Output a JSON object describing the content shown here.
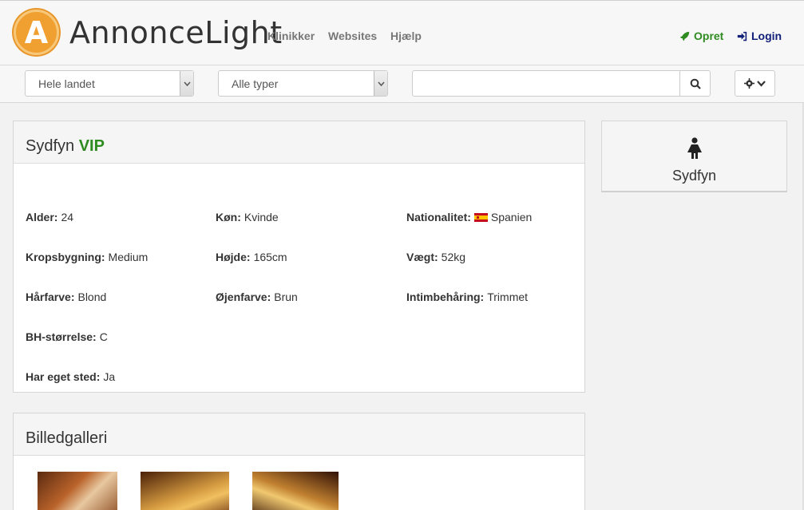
{
  "header": {
    "logo_letter": "A",
    "brand_strong": "Annonce",
    "brand_light": "Light",
    "nav": [
      "Klinikker",
      "Websites",
      "Hjælp"
    ],
    "opret_label": "Opret",
    "login_label": "Login"
  },
  "filters": {
    "region_value": "Hele landet",
    "type_value": "Alle typer",
    "search_value": ""
  },
  "profile": {
    "title": "Sydfyn",
    "badge": "VIP",
    "attributes": [
      {
        "label": "Alder:",
        "value": "24"
      },
      {
        "label": "Køn:",
        "value": "Kvinde"
      },
      {
        "label": "Nationalitet:",
        "value": "Spanien"
      },
      {
        "label": "Kropsbygning:",
        "value": "Medium"
      },
      {
        "label": "Højde:",
        "value": "165cm"
      },
      {
        "label": "Vægt:",
        "value": "52kg"
      },
      {
        "label": "Hårfarve:",
        "value": "Blond"
      },
      {
        "label": "Øjenfarve:",
        "value": "Brun"
      },
      {
        "label": "Intimbehåring:",
        "value": "Trimmet"
      },
      {
        "label": "BH-størrelse:",
        "value": "C"
      },
      {
        "label": "Har eget sted:",
        "value": "Ja"
      }
    ]
  },
  "gallery": {
    "title": "Billedgalleri"
  },
  "side": {
    "location": "Sydfyn",
    "icon": "female-icon"
  },
  "colors": {
    "accent_green": "#2e8b1f",
    "login_blue": "#12207a",
    "logo_orange": "#f0a030"
  }
}
